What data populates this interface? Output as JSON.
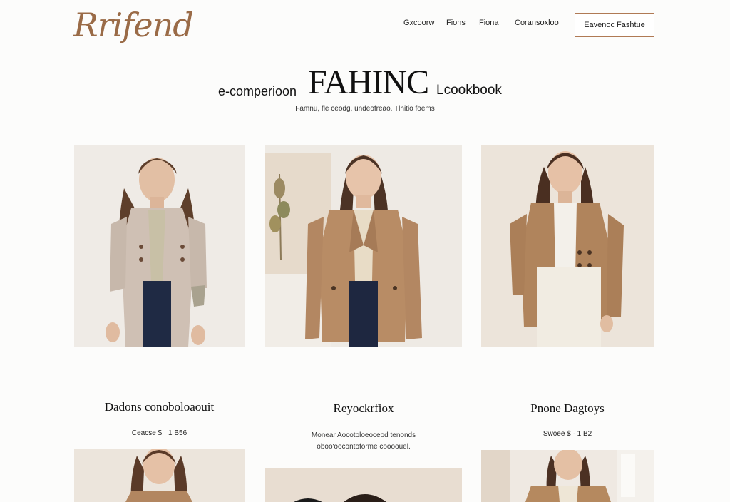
{
  "brand": {
    "logo_text": "Rrifend",
    "logo_dots": "..."
  },
  "nav": {
    "items": [
      "Gxcoorw",
      "Fions",
      "Fiona",
      "Coransoxloo"
    ],
    "cta_label": "Eavenoc Fashtue"
  },
  "hero": {
    "left_text": "e-comperioon",
    "title": "FAHINC",
    "right_text": "Lcookbook",
    "subtitle": "Famnu, fle ceodg, undeofreao.  Tlhitio foems"
  },
  "cards": [
    {
      "title": "Dadons conoboloaouit",
      "meta": "Ceacse $ · 1 B56"
    },
    {
      "title": "Reyockrfiox",
      "desc_line1": "Monear Aocotoloeoceod tenonds",
      "desc_line2": "oboo'oocontoforme coooouel."
    },
    {
      "title": "Pnone Dagtoys",
      "meta": "Swoee $ · 1 B2"
    }
  ],
  "colors": {
    "accent": "#9a6b47",
    "cta_border": "#b07a55",
    "background": "#fcfcfb"
  }
}
